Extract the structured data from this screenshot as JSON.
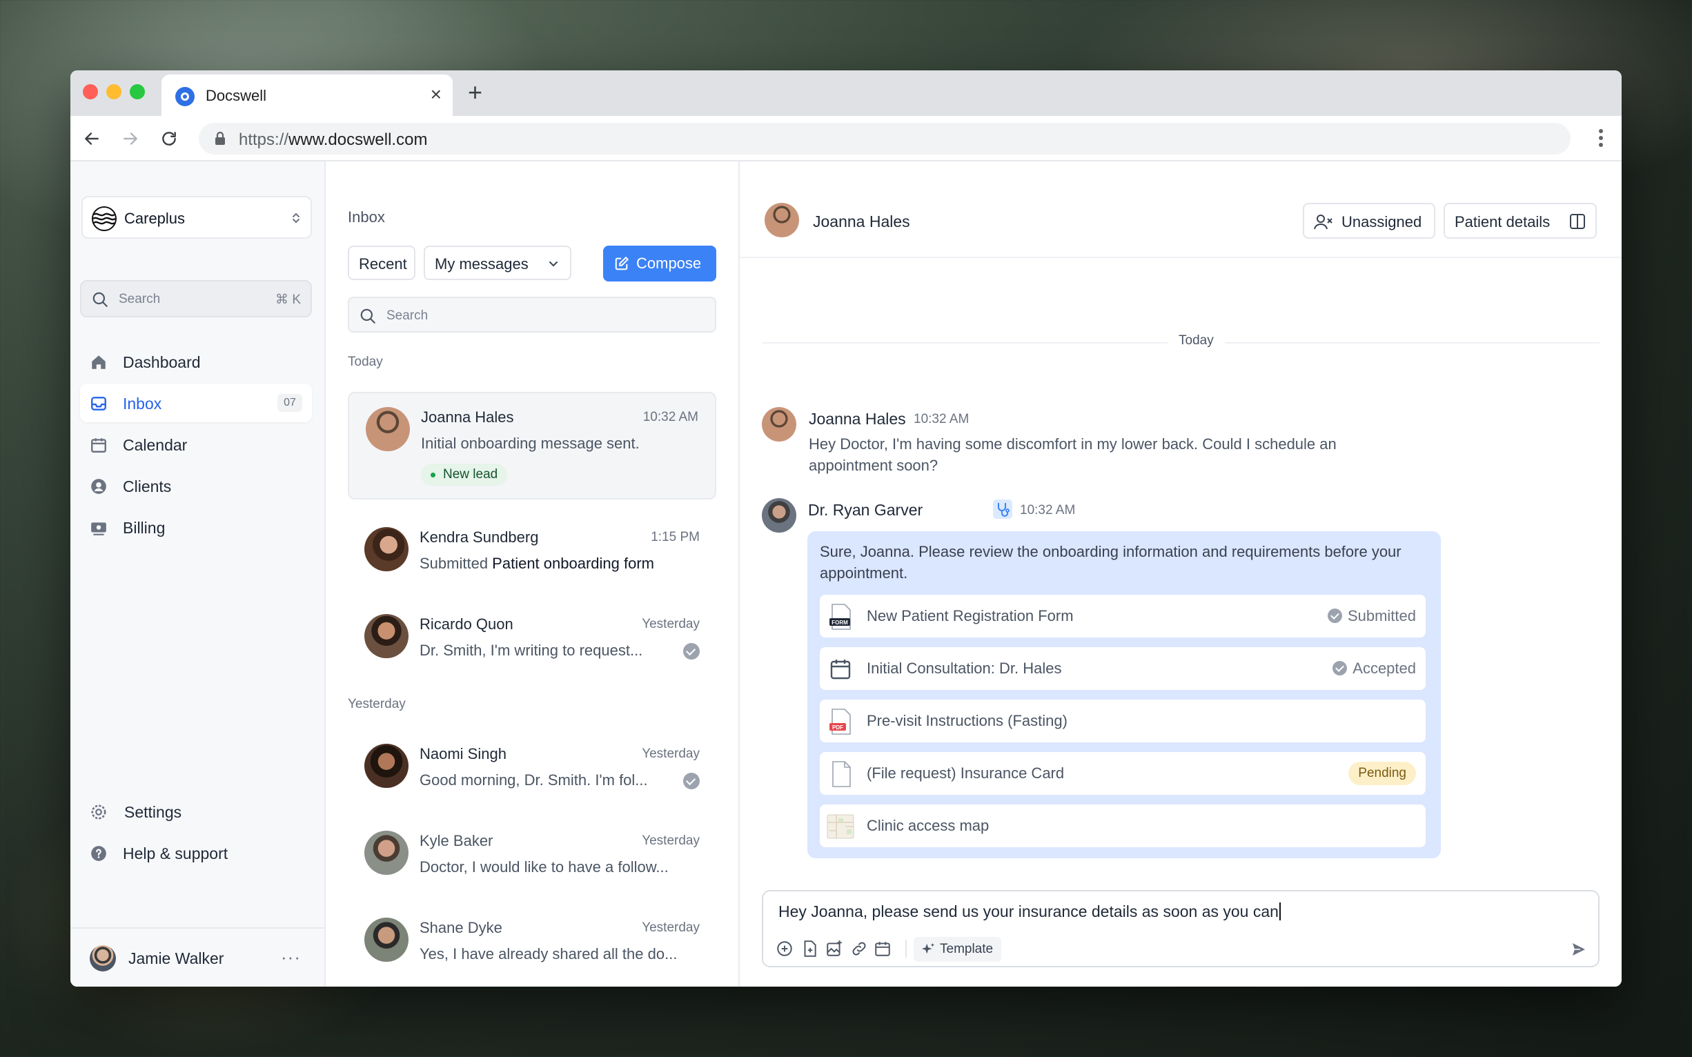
{
  "browser": {
    "tab_title": "Docswell",
    "url_scheme": "https://",
    "url_host": "www.docswell.com"
  },
  "sidebar": {
    "workspace": "Careplus",
    "search_placeholder": "Search",
    "search_shortcut": "⌘ K",
    "nav": [
      {
        "label": "Dashboard",
        "icon": "home-icon"
      },
      {
        "label": "Inbox",
        "icon": "inbox-icon",
        "count": "07",
        "active": true
      },
      {
        "label": "Calendar",
        "icon": "calendar-icon"
      },
      {
        "label": "Clients",
        "icon": "user-circle-icon"
      },
      {
        "label": "Billing",
        "icon": "billing-icon"
      }
    ],
    "footer": [
      {
        "label": "Settings",
        "icon": "gear-icon"
      },
      {
        "label": "Help & support",
        "icon": "help-icon"
      }
    ],
    "user": {
      "name": "Jamie Walker",
      "more": "···"
    }
  },
  "inbox": {
    "title": "Inbox",
    "filter_recent": "Recent",
    "filter_scope": "My messages",
    "compose": "Compose",
    "search_placeholder": "Search",
    "sections": {
      "today": "Today",
      "yesterday": "Yesterday"
    },
    "messages": [
      {
        "name": "Joanna Hales",
        "time": "10:32 AM",
        "preview": "Initial onboarding message sent.",
        "tag": "New lead"
      },
      {
        "name": "Kendra Sundberg",
        "time": "1:15 PM",
        "preview_prefix": "Submitted ",
        "preview_strong": "Patient onboarding form"
      },
      {
        "name": "Ricardo Quon",
        "time": "Yesterday",
        "preview": "Dr. Smith, I'm writing to request..."
      },
      {
        "name": "Naomi Singh",
        "time": "Yesterday",
        "preview": "Good morning, Dr. Smith. I'm fol..."
      },
      {
        "name": "Kyle Baker",
        "time": "Yesterday",
        "preview": "Doctor, I would like to have a follow..."
      },
      {
        "name": "Shane Dyke",
        "time": "Yesterday",
        "preview": "Yes, I have already shared all the do..."
      }
    ]
  },
  "conversation": {
    "contact": "Joanna Hales",
    "assign": "Unassigned",
    "details": "Patient details",
    "day": "Today",
    "patient_msg": {
      "name": "Joanna Hales",
      "time": "10:32 AM",
      "text": "Hey Doctor, I'm having some discomfort in my lower back. Could I schedule an appointment soon?"
    },
    "doctor_msg": {
      "name": "Dr. Ryan Garver",
      "time": "10:32 AM",
      "text": "Sure, Joanna. Please review the onboarding information and requirements before your appointment.",
      "attachments": [
        {
          "label": "New Patient Registration Form",
          "status": "Submitted",
          "icon": "form-file-icon"
        },
        {
          "label": "Initial Consultation: Dr. Hales",
          "status": "Accepted",
          "icon": "calendar-icon"
        },
        {
          "label": "Pre-visit Instructions (Fasting)",
          "status": "",
          "icon": "pdf-file-icon"
        },
        {
          "label": "(File request) Insurance Card",
          "status": "Pending",
          "icon": "blank-file-icon"
        },
        {
          "label": "Clinic access map",
          "status": "",
          "icon": "map-thumbnail-icon"
        }
      ]
    },
    "composer": {
      "text": "Hey Joanna, please send us your insurance details as soon as you can",
      "template": "Template"
    }
  },
  "colors": {
    "accent": "#3b82f6",
    "bubble": "#dbe6ff",
    "lead_pill": "#e6f4ea",
    "pending_pill": "#fdf0c9"
  }
}
